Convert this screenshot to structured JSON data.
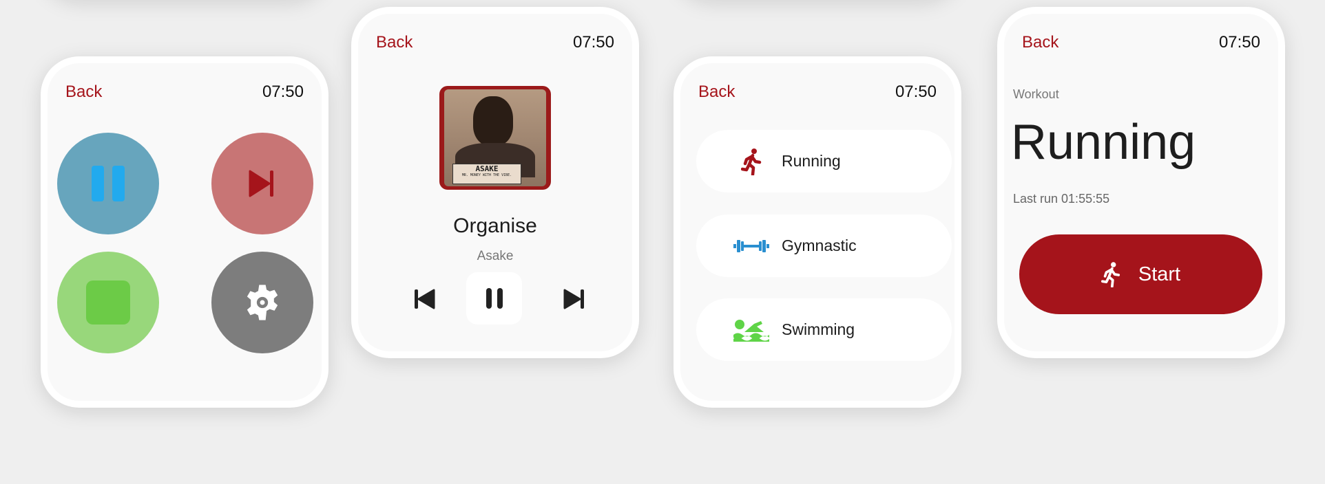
{
  "common": {
    "back_label": "Back",
    "time": "07:50"
  },
  "controls_screen": {
    "buttons": [
      "pause",
      "next",
      "stop",
      "settings"
    ]
  },
  "now_playing": {
    "title": "Organise",
    "artist": "Asake",
    "album_art_text": {
      "name": "ASAKE",
      "subtitle": "MR. MONEY WITH THE VIBE."
    }
  },
  "workouts": {
    "items": [
      {
        "label": "Running",
        "icon": "running-icon",
        "color": "#a5141b"
      },
      {
        "label": "Gymnastic",
        "icon": "dumbbell-icon",
        "color": "#2a8fd0"
      },
      {
        "label": "Swimming",
        "icon": "swimming-icon",
        "color": "#5fd447"
      }
    ]
  },
  "workout_detail": {
    "section": "Workout",
    "title": "Running",
    "last_run": "Last run 01:55:55",
    "start_label": "Start"
  },
  "colors": {
    "accent": "#a5141b",
    "blue": "#67a5bd",
    "red": "#c87575",
    "green": "#98d77b",
    "gray": "#7d7d7d"
  }
}
